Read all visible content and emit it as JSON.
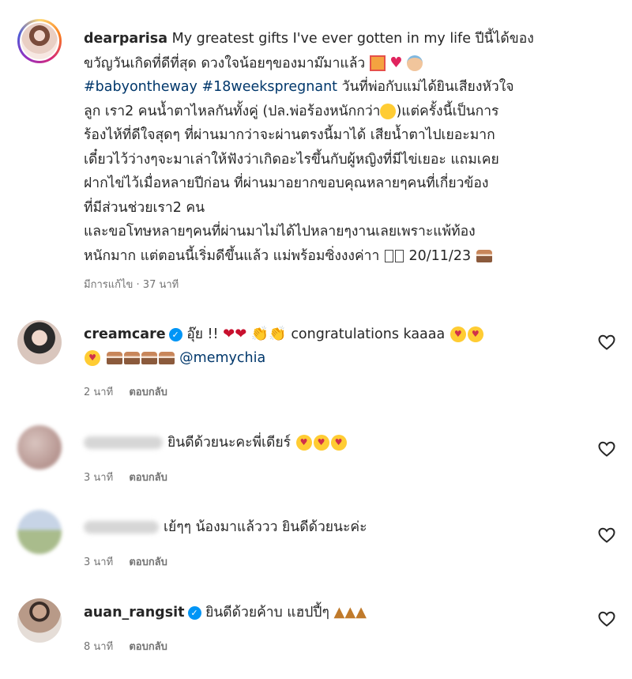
{
  "post": {
    "username": "dearparisa",
    "caption_line1": "My greatest gifts I've ever gotten in my life ปีนี้ได้ของ",
    "caption_line2": "ขวัญวันเกิดที่ดีที่สุด ดวงใจน้อยๆของมาม๊มาแล้ว",
    "hashtag1": "#babyontheway",
    "hashtag2": "#18weekspregnant",
    "caption_line3_rest": "วันที่พ่อกับแม่ได้ยินเสียงหัวใจ",
    "caption_line4": "ลูก เรา2 คนน้ำตาไหลกันทั้งคู่ (ปล.พ่อร้องหนักกว่า",
    "caption_line4_end": ")แต่ครั้งนี้เป็นการ",
    "caption_line5": "ร้องไห้ที่ดีใจสุดๆ ที่ผ่านมากว่าจะผ่านตรงนี้มาได้ เสียน้ำตาไปเยอะมาก",
    "caption_line6": "เดี๋ยวไว้ว่างๆจะมาเล่าให้ฟังว่าเกิดอะไรขึ้นกับผู้หญิงที่มีไข่เยอะ แถมเคย",
    "caption_line7": "ฝากไข่ไว้เมื่อหลายปีก่อน ที่ผ่านมาอยากขอบคุณหลายๆคนที่เกี่ยวข้อง",
    "caption_line8": "ที่มีส่วนช่วยเรา2 คน",
    "caption_line9": "และขอโทษหลายๆคนที่ผ่านมาไม่ได้ไปหลายๆงานเลยเพราะแพ้ท้อง",
    "caption_line10": "หนักมาก แต่ตอนนี้เริ่มดีขึ้นแล้ว แม่พร้อมซิ่งงงค่าา",
    "caption_date": "20/11/23",
    "meta": "มีการแก้ไข · 37 นาที"
  },
  "comments": [
    {
      "username": "creamcare",
      "verified": true,
      "text_start": "อุ๊ย !!",
      "text_mid": "congratulations kaaaa",
      "mention": "@memychia",
      "time": "2 นาที",
      "reply": "ตอบกลับ"
    },
    {
      "username": "",
      "verified": false,
      "text": "ยินดีด้วยนะคะพี่เดียร์",
      "time": "3 นาที",
      "reply": "ตอบกลับ"
    },
    {
      "username": "",
      "verified": false,
      "text": "เย้ๆๆ น้องมาแล้ววว ยินดีด้วยนะค่ะ",
      "time": "3 นาที",
      "reply": "ตอบกลับ"
    },
    {
      "username": "auan_rangsit",
      "verified": true,
      "text": "ยินดีด้วยค้าบ แฮปปี้ๆ",
      "time": "8 นาที",
      "reply": "ตอบกลับ"
    }
  ],
  "icons": {
    "like": "heart-outline-icon",
    "verified": "verified-badge-icon"
  },
  "colors": {
    "link": "#00376b",
    "verified": "#0095f6",
    "meta": "#737373"
  }
}
